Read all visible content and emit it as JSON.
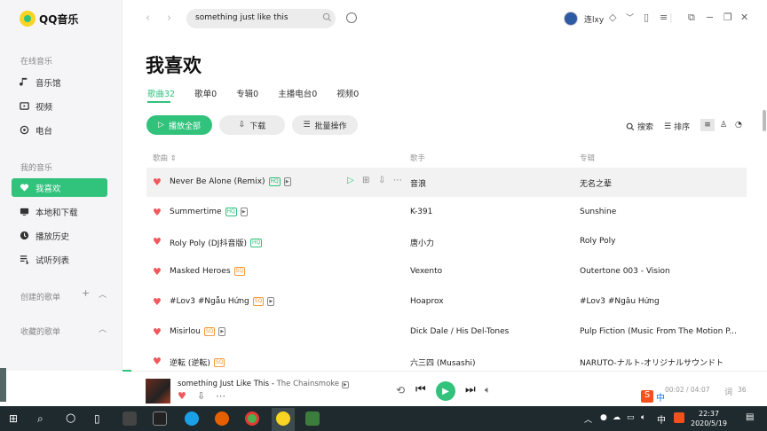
{
  "app": {
    "name": "QQ音乐"
  },
  "sidebar": {
    "section_online": "在线音乐",
    "online_items": [
      {
        "label": "音乐馆",
        "icon": "music-note-icon"
      },
      {
        "label": "视频",
        "icon": "video-icon"
      },
      {
        "label": "电台",
        "icon": "radio-icon"
      }
    ],
    "section_mine": "我的音乐",
    "mine_items": [
      {
        "label": "我喜欢",
        "icon": "heart-icon",
        "active": true
      },
      {
        "label": "本地和下载",
        "icon": "monitor-icon"
      },
      {
        "label": "播放历史",
        "icon": "clock-icon"
      },
      {
        "label": "试听列表",
        "icon": "list-icon"
      }
    ],
    "section_created": "创建的歌单",
    "section_collected": "收藏的歌单"
  },
  "topbar": {
    "search_value": "something just like this",
    "username": "连lxy"
  },
  "page": {
    "title": "我喜欢",
    "tabs": [
      {
        "label": "歌曲32",
        "active": true
      },
      {
        "label": "歌单0"
      },
      {
        "label": "专辑0"
      },
      {
        "label": "主播电台0"
      },
      {
        "label": "视频0"
      }
    ],
    "play_all": "播放全部",
    "download": "下载",
    "batch": "批量操作",
    "search_label": "搜索",
    "sort_label": "排序"
  },
  "table": {
    "headers": {
      "song": "歌曲",
      "artist": "歌手",
      "album": "专辑"
    },
    "rows": [
      {
        "song": "Never Be Alone (Remix)",
        "badge": "HQ",
        "mv": true,
        "artist": "音浪",
        "album": "无名之辈"
      },
      {
        "song": "Summertime",
        "badge": "HQ",
        "mv": true,
        "artist": "K-391",
        "album": "Sunshine"
      },
      {
        "song": "Roly Poly (DJ抖音版)",
        "badge": "HQ",
        "mv": false,
        "artist": "唐小力",
        "album": "Roly Poly"
      },
      {
        "song": "Masked Heroes",
        "badge": "SQ",
        "mv": false,
        "artist": "Vexento",
        "album": "Outertone 003 - Vision"
      },
      {
        "song": "#Lov3 #Ngẫu Hứng",
        "badge": "SQ",
        "mv": true,
        "artist": "Hoaprox",
        "album": "#Lov3 #Ngẫu Hứng"
      },
      {
        "song": "Misirlou",
        "badge": "SQ",
        "mv": true,
        "artist": "Dick Dale / His Del-Tones",
        "album": "Pulp Fiction (Music From The Motion P..."
      },
      {
        "song": "逆転 (逆転)",
        "badge": "SQ",
        "mv": false,
        "artist": "六三四 (Musashi)",
        "album": "NARUTO-ナルト-オリジナルサウンドト"
      }
    ]
  },
  "player": {
    "title": "something Just Like This",
    "artist": "The Chainsmoke",
    "time": "00:02 / 04:07",
    "lyric_label": "词",
    "count": "36"
  },
  "taskbar": {
    "time": "22:37",
    "date": "2020/5/19",
    "ime": "中"
  },
  "colors": {
    "accent": "#31c27c",
    "heart": "#f1585c",
    "sq": "#f39a39"
  }
}
